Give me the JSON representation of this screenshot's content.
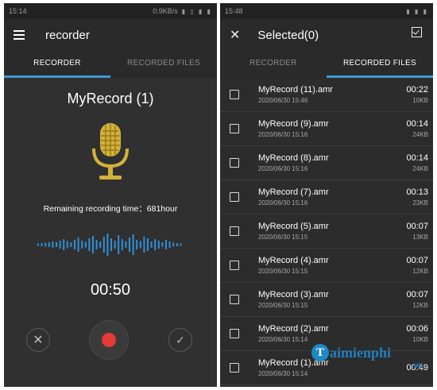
{
  "left": {
    "status": {
      "time": "15:14",
      "net": "0.9KB/s"
    },
    "toolbar": {
      "title": "recorder"
    },
    "tabs": [
      {
        "label": "RECORDER"
      },
      {
        "label": "RECORDED FILES"
      }
    ],
    "active_tab": 0,
    "record_name": "MyRecord (1)",
    "remaining": "Remaining recording time：681hour",
    "timer": "00:50",
    "icons": {
      "menu": "hamburger-icon",
      "mic": "microphone-icon",
      "cancel": "close-icon",
      "record": "record-icon",
      "done": "check-icon"
    }
  },
  "right": {
    "status": {
      "time": "15:48"
    },
    "toolbar": {
      "title": "Selected(0)"
    },
    "tabs": [
      {
        "label": "RECORDER"
      },
      {
        "label": "RECORDED FILES"
      }
    ],
    "active_tab": 1,
    "files": [
      {
        "name": "MyRecord (11).amr",
        "date": "2020/06/30 15:46",
        "duration": "00:22",
        "size": "10KB"
      },
      {
        "name": "MyRecord (9).amr",
        "date": "2020/06/30 15:16",
        "duration": "00:14",
        "size": "24KB"
      },
      {
        "name": "MyRecord (8).amr",
        "date": "2020/06/30 15:16",
        "duration": "00:14",
        "size": "24KB"
      },
      {
        "name": "MyRecord (7).amr",
        "date": "2020/06/30 15:16",
        "duration": "00:13",
        "size": "23KB"
      },
      {
        "name": "MyRecord (5).amr",
        "date": "2020/06/30 15:15",
        "duration": "00:07",
        "size": "13KB"
      },
      {
        "name": "MyRecord (4).amr",
        "date": "2020/06/30 15:15",
        "duration": "00:07",
        "size": "12KB"
      },
      {
        "name": "MyRecord (3).amr",
        "date": "2020/06/30 15:15",
        "duration": "00:07",
        "size": "12KB"
      },
      {
        "name": "MyRecord (2).amr",
        "date": "2020/06/30 15:14",
        "duration": "00:06",
        "size": "10KB"
      },
      {
        "name": "MyRecord (1).amr",
        "date": "2020/06/30 15:14",
        "duration": "00:49",
        "size": ""
      }
    ]
  },
  "watermark": {
    "brand": "aimienphi",
    "initial": "T",
    "tld": ".vn"
  },
  "colors": {
    "accent": "#3d9bd8",
    "record": "#e53935",
    "mic_gold": "#d4b13a",
    "wave_blue": "#2f8fd8"
  }
}
